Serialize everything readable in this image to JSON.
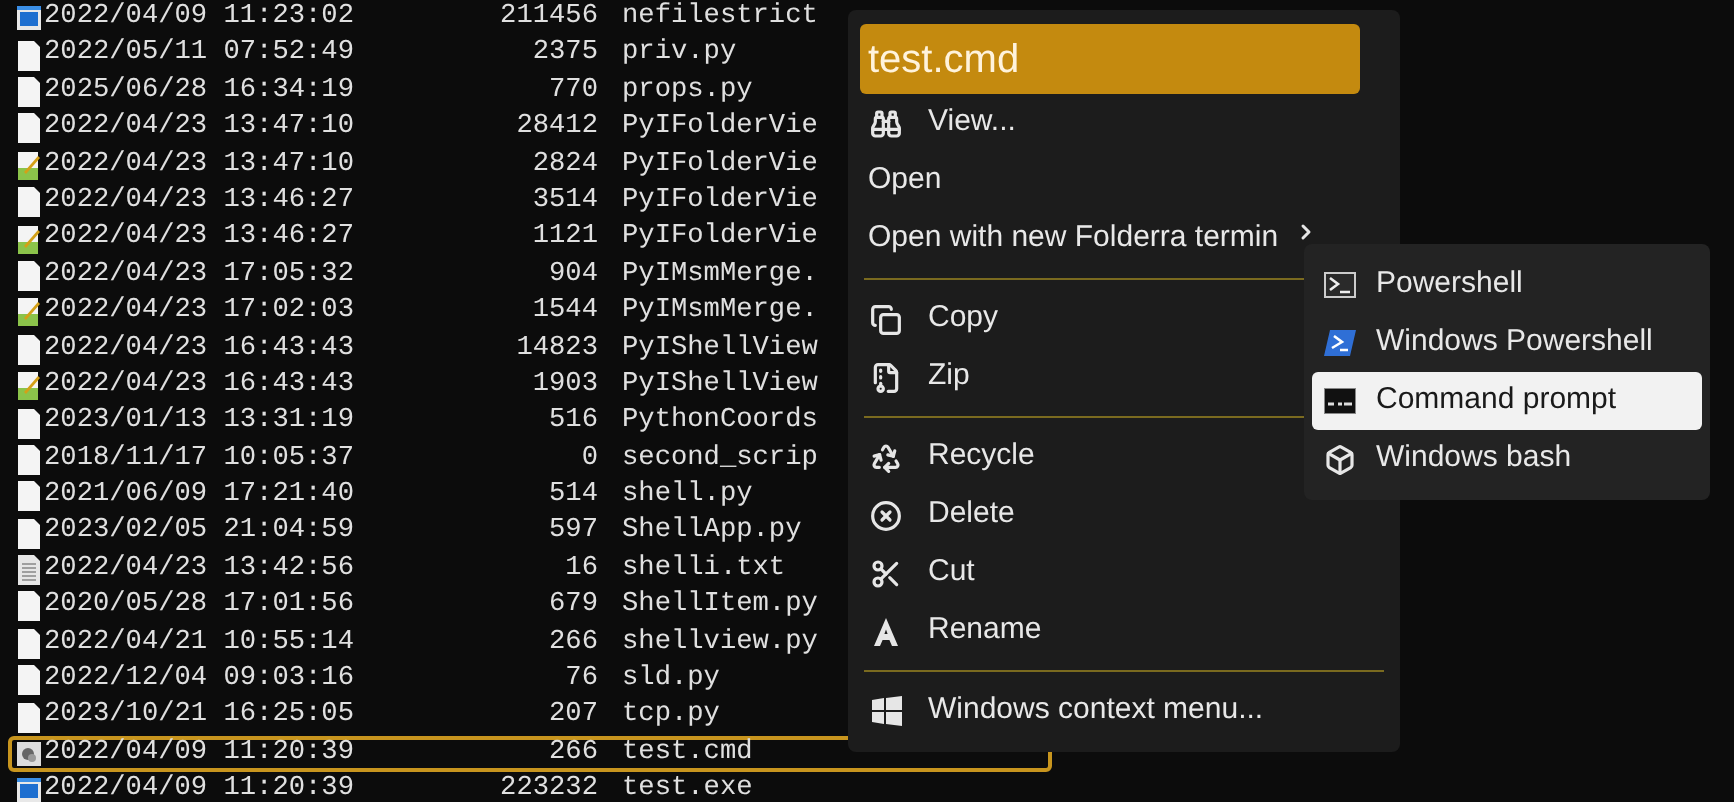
{
  "files": [
    {
      "kind": "exe",
      "date": "2022/04/09 11:23:02",
      "size": "211456",
      "name": "nefilestrict",
      "selected": false
    },
    {
      "kind": "file",
      "date": "2022/05/11 07:52:49",
      "size": "2375",
      "name": "priv.py",
      "selected": false
    },
    {
      "kind": "file",
      "date": "2025/06/28 16:34:19",
      "size": "770",
      "name": "props.py",
      "selected": false
    },
    {
      "kind": "file",
      "date": "2022/04/23 13:47:10",
      "size": "28412",
      "name": "PyIFolderVie",
      "selected": false
    },
    {
      "kind": "script",
      "date": "2022/04/23 13:47:10",
      "size": "2824",
      "name": "PyIFolderVie",
      "selected": false
    },
    {
      "kind": "file",
      "date": "2022/04/23 13:46:27",
      "size": "3514",
      "name": "PyIFolderVie",
      "selected": false
    },
    {
      "kind": "script",
      "date": "2022/04/23 13:46:27",
      "size": "1121",
      "name": "PyIFolderVie",
      "selected": false
    },
    {
      "kind": "file",
      "date": "2022/04/23 17:05:32",
      "size": "904",
      "name": "PyIMsmMerge.",
      "selected": false
    },
    {
      "kind": "script",
      "date": "2022/04/23 17:02:03",
      "size": "1544",
      "name": "PyIMsmMerge.",
      "selected": false
    },
    {
      "kind": "file",
      "date": "2022/04/23 16:43:43",
      "size": "14823",
      "name": "PyIShellView",
      "selected": false
    },
    {
      "kind": "script",
      "date": "2022/04/23 16:43:43",
      "size": "1903",
      "name": "PyIShellView",
      "selected": false
    },
    {
      "kind": "file",
      "date": "2023/01/13 13:31:19",
      "size": "516",
      "name": "PythonCoords",
      "selected": false
    },
    {
      "kind": "file",
      "date": "2018/11/17 10:05:37",
      "size": "0",
      "name": "second_scrip",
      "selected": false
    },
    {
      "kind": "file",
      "date": "2021/06/09 17:21:40",
      "size": "514",
      "name": "shell.py",
      "selected": false
    },
    {
      "kind": "file",
      "date": "2023/02/05 21:04:59",
      "size": "597",
      "name": "ShellApp.py",
      "selected": false
    },
    {
      "kind": "text",
      "date": "2022/04/23 13:42:56",
      "size": "16",
      "name": "shelli.txt",
      "selected": false
    },
    {
      "kind": "file",
      "date": "2020/05/28 17:01:56",
      "size": "679",
      "name": "ShellItem.py",
      "selected": false
    },
    {
      "kind": "file",
      "date": "2022/04/21 10:55:14",
      "size": "266",
      "name": "shellview.py",
      "selected": false
    },
    {
      "kind": "file",
      "date": "2022/12/04 09:03:16",
      "size": "76",
      "name": "sld.py",
      "selected": false
    },
    {
      "kind": "file",
      "date": "2023/10/21 16:25:05",
      "size": "207",
      "name": "tcp.py",
      "selected": false
    },
    {
      "kind": "cmd",
      "date": "2022/04/09 11:20:39",
      "size": "266",
      "name": "test.cmd",
      "selected": true
    },
    {
      "kind": "exe",
      "date": "2022/04/09 11:20:39",
      "size": "223232",
      "name": "test.exe",
      "selected": false
    }
  ],
  "context_menu": {
    "header": "test.cmd",
    "items": [
      {
        "kind": "binoculars",
        "label": "View..."
      },
      {
        "kind": "plain",
        "label": "Open"
      },
      {
        "kind": "submenu",
        "label": "Open with new Folderra termin"
      },
      {
        "kind": "separator"
      },
      {
        "kind": "copy",
        "label": "Copy"
      },
      {
        "kind": "zip",
        "label": "Zip"
      },
      {
        "kind": "separator"
      },
      {
        "kind": "recycle",
        "label": "Recycle"
      },
      {
        "kind": "delete",
        "label": "Delete"
      },
      {
        "kind": "cut",
        "label": "Cut"
      },
      {
        "kind": "rename",
        "label": "Rename"
      },
      {
        "kind": "separator"
      },
      {
        "kind": "windows",
        "label": "Windows context menu..."
      }
    ]
  },
  "submenu": {
    "items": [
      {
        "kind": "terminal",
        "label": "Powershell",
        "selected": false
      },
      {
        "kind": "powershell",
        "label": "Windows Powershell",
        "selected": false
      },
      {
        "kind": "cmd",
        "label": "Command prompt",
        "selected": true
      },
      {
        "kind": "cube",
        "label": "Windows bash",
        "selected": false
      }
    ]
  }
}
